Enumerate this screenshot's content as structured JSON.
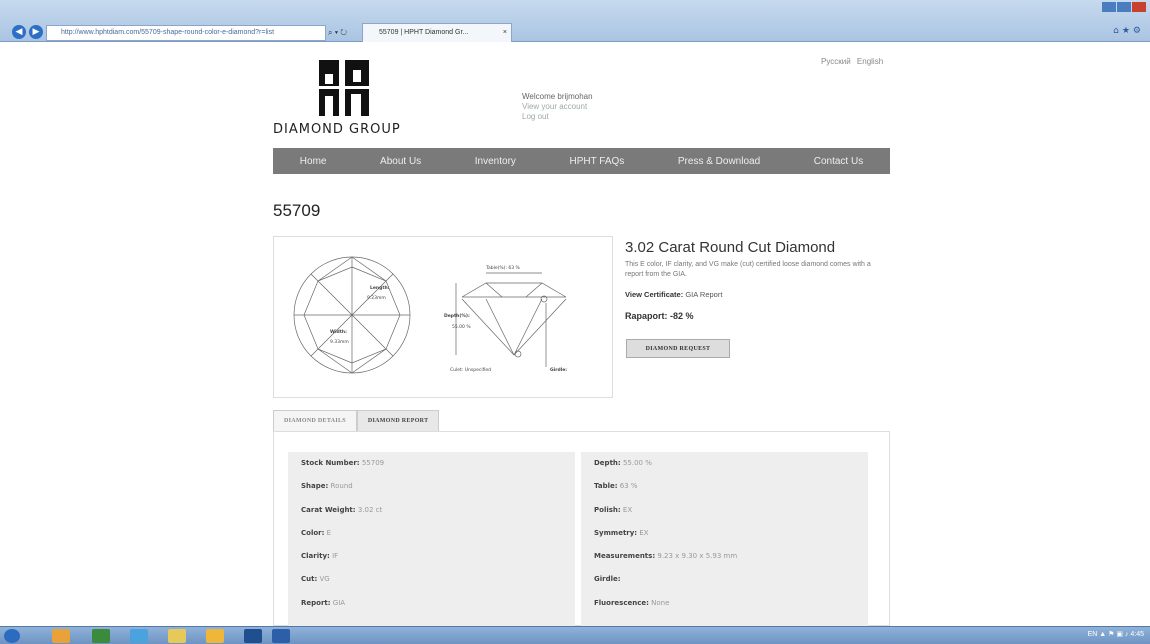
{
  "browser": {
    "address": "http://www.hphtdiam.com/55709-shape-round-color-e-diamond?r=list",
    "address_controls": "⌕ ▾ ↻",
    "tab_title": "55709 | HPHT Diamond Gr...",
    "tab_close": "×",
    "back": "◀",
    "forward": "▶",
    "tools": "⌂★⚙"
  },
  "header": {
    "logo_mark": "HPHT",
    "logo_text": "DIAMOND GROUP",
    "welcome": "Welcome brijmohan",
    "view_account": "View your account",
    "logout": "Log out",
    "lang_ru": "Русский",
    "lang_en": "English"
  },
  "nav": [
    "Home",
    "About Us",
    "Inventory",
    "HPHT FAQs",
    "Press & Download",
    "Contact Us"
  ],
  "product": {
    "sku": "55709",
    "title": "3.02 Carat Round Cut Diamond",
    "description": "This E color, IF clarity, and VG make (cut) certified loose diamond comes with a report from the GIA.",
    "cert_label": "View Certificate:",
    "cert_value": "GIA Report",
    "rapaport": "Rapaport: -82 %",
    "request_button": "DIAMOND REQUEST"
  },
  "diagram": {
    "length_label": "Length:",
    "length_value": "9.23mm",
    "width_label": "Width:",
    "width_value": "9.33mm",
    "table_label": "Table(%): 63 %",
    "depth_label": "Depth(%):",
    "depth_value": "55.00 %",
    "culet_label": "Culet: Unspecified",
    "girdle_label": "Girdle:"
  },
  "tabs": [
    "DIAMOND DETAILS",
    "DIAMOND REPORT"
  ],
  "details_left": [
    {
      "k": "Stock Number:",
      "v": "55709"
    },
    {
      "k": "Shape:",
      "v": "Round"
    },
    {
      "k": "Carat Weight:",
      "v": "3.02 ct"
    },
    {
      "k": "Color:",
      "v": "E"
    },
    {
      "k": "Clarity:",
      "v": "IF"
    },
    {
      "k": "Cut:",
      "v": "VG"
    },
    {
      "k": "Report:",
      "v": "GIA"
    }
  ],
  "details_right": [
    {
      "k": "Depth:",
      "v": "55.00 %"
    },
    {
      "k": "Table:",
      "v": "63 %"
    },
    {
      "k": "Polish:",
      "v": "EX"
    },
    {
      "k": "Symmetry:",
      "v": "EX"
    },
    {
      "k": "Measurements:",
      "v": "9.23 x 9.30 x 5.93 mm"
    },
    {
      "k": "Girdle:",
      "v": ""
    },
    {
      "k": "Fluorescence:",
      "v": "None"
    }
  ],
  "taskbar": {
    "tray": "EN ▲ ⚑ ▣ ♪   4:45"
  },
  "colors": {
    "nav_bg": "#7a7a7a",
    "browser_chrome": "#b8cfe9",
    "taskbar": "#7ea4cf"
  }
}
